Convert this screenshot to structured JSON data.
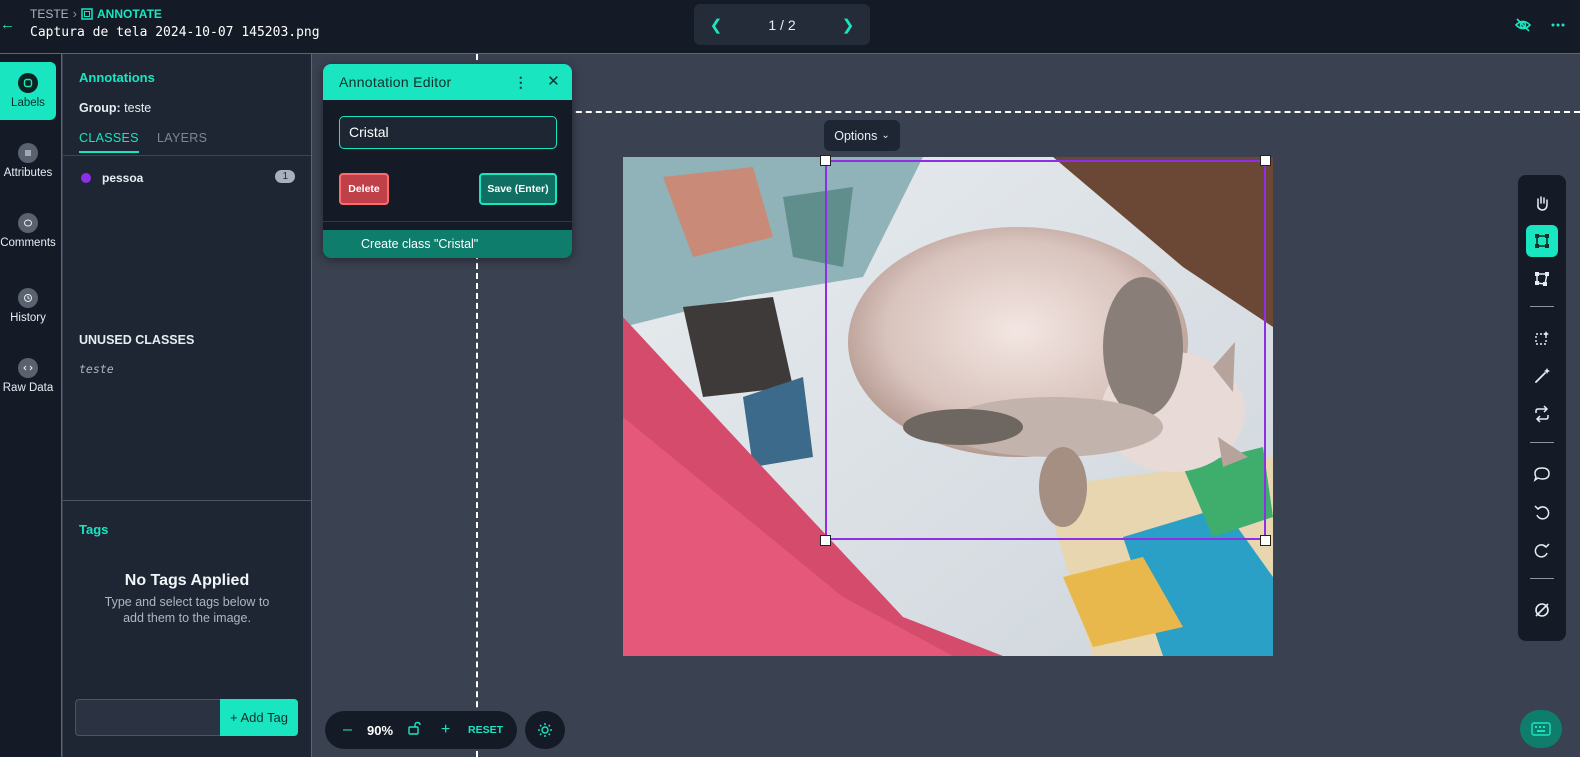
{
  "header": {
    "project": "TESTE",
    "mode": "ANNOTATE",
    "filename": "Captura de tela 2024-10-07 145203.png",
    "pager": "1 / 2"
  },
  "rail": {
    "items": [
      {
        "label": "Labels",
        "icon": "tag-icon"
      },
      {
        "label": "Attributes",
        "icon": "list-icon"
      },
      {
        "label": "Comments",
        "icon": "comment-icon"
      },
      {
        "label": "History",
        "icon": "history-icon"
      },
      {
        "label": "Raw Data",
        "icon": "code-icon"
      }
    ]
  },
  "panel": {
    "title": "Annotations",
    "group_label": "Group:",
    "group_value": "teste",
    "tabs": [
      "CLASSES",
      "LAYERS"
    ],
    "classes": [
      {
        "name": "pessoa",
        "count": "1",
        "color": "#8e2ee6"
      }
    ],
    "unused_title": "UNUSED CLASSES",
    "unused": [
      "teste"
    ],
    "tags_title": "Tags",
    "no_tags_title": "No Tags Applied",
    "no_tags_sub": "Type and select tags below to add them to the image.",
    "add_tag": "+ Add Tag"
  },
  "editor": {
    "title": "Annotation Editor",
    "input_value": "Cristal",
    "delete": "Delete",
    "save": "Save (Enter)",
    "create": "Create class \"Cristal\""
  },
  "canvas": {
    "options": "Options",
    "zoom": "90%",
    "reset": "RESET"
  },
  "colors": {
    "accent": "#19e6c1",
    "box": "#8e2ee6",
    "bg": "#3a4150"
  }
}
